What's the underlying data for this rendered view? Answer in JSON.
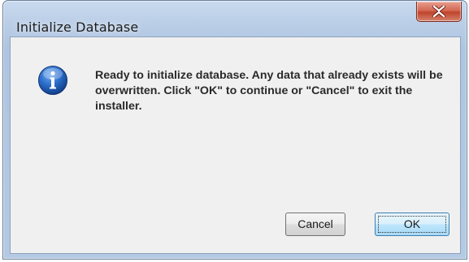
{
  "window": {
    "title": "Initialize Database",
    "close_icon": "close-icon"
  },
  "dialog": {
    "icon": "info-icon",
    "message": "Ready to initialize database. Any data that already exists will be overwritten. Click \"OK\" to continue or \"Cancel\" to exit the installer."
  },
  "buttons": {
    "cancel_label": "Cancel",
    "ok_label": "OK"
  },
  "colors": {
    "frame": "#b9cde6",
    "client": "#f0f0f0",
    "close_button": "#c7482f",
    "info_icon": "#1e5eb8",
    "default_button_border": "#3c7fb1"
  }
}
